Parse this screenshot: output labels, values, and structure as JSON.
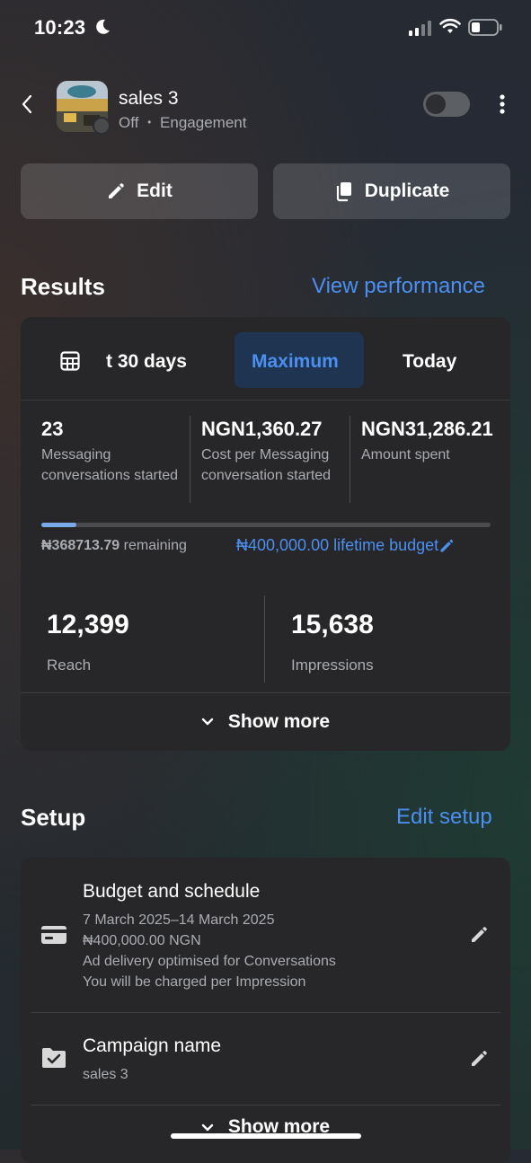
{
  "status_bar": {
    "time": "10:23"
  },
  "campaign": {
    "name": "sales 3",
    "status": "Off",
    "separator": "•",
    "objective": "Engagement"
  },
  "actions": {
    "edit": "Edit",
    "duplicate": "Duplicate"
  },
  "results": {
    "title": "Results",
    "view_performance": "View performance",
    "tabs": {
      "last30": "t 30 days",
      "maximum": "Maximum",
      "today": "Today",
      "selected": "Maximum"
    },
    "metrics": [
      {
        "value": "23",
        "label": "Messaging conversations started"
      },
      {
        "value": "NGN1,360.27",
        "label": "Cost per Messaging conversation started"
      },
      {
        "value": "NGN31,286.21",
        "label": "Amount spent"
      }
    ],
    "budget": {
      "remaining_amount": "₦368713.79",
      "remaining_text": "remaining",
      "lifetime_budget": "₦400,000.00 lifetime budget",
      "progress_fraction": 0.078
    },
    "reach": {
      "value": "12,399",
      "label": "Reach"
    },
    "impressions": {
      "value": "15,638",
      "label": "Impressions"
    },
    "show_more": "Show more"
  },
  "setup": {
    "title": "Setup",
    "edit_setup": "Edit setup",
    "budget_schedule": {
      "title": "Budget and schedule",
      "dates": "7 March 2025–14 March 2025",
      "amount": "₦400,000.00 NGN",
      "delivery": "Ad delivery optimised for Conversations",
      "charge": "You will be charged per Impression"
    },
    "campaign_name": {
      "title": "Campaign name",
      "value": "sales 3"
    },
    "show_more": "Show more"
  },
  "colors": {
    "accent": "#4b8ff0",
    "card": "#272729",
    "selected_tab": "#1e3450"
  }
}
